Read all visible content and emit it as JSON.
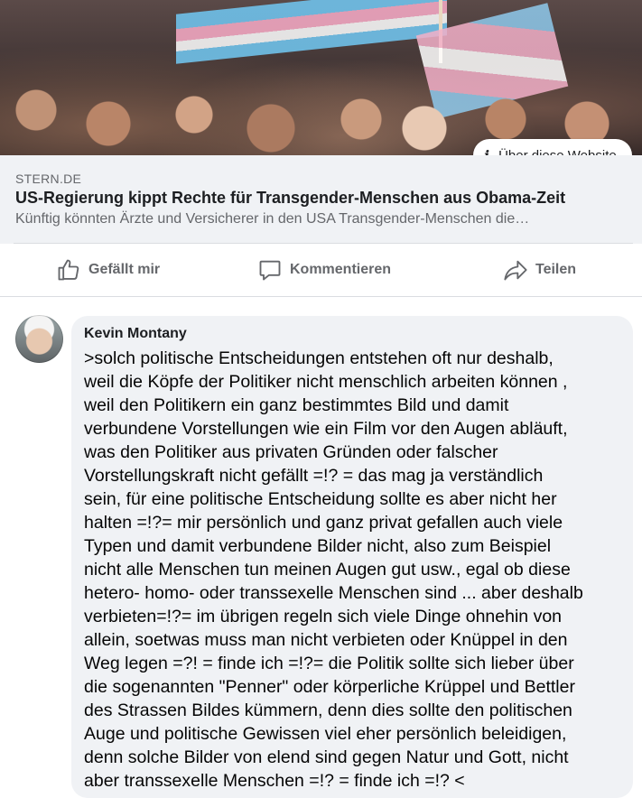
{
  "link_preview": {
    "about_label": "Über diese Website",
    "domain": "STERN.DE",
    "title": "US-Regierung kippt Rechte für Transgender-Menschen aus Obama-Zeit",
    "description": "Künftig könnten Ärzte und Versicherer in den USA Transgender-Menschen die…"
  },
  "actions": {
    "like": "Gefällt mir",
    "comment": "Kommentieren",
    "share": "Teilen"
  },
  "comment": {
    "author": "Kevin Montany",
    "text": ">solch politische Entscheidungen entstehen oft nur deshalb,\nweil die Köpfe der Politiker nicht menschlich arbeiten können ,\nweil den Politikern ein ganz bestimmtes Bild und damit\nverbundene Vorstellungen wie ein Film vor den Augen abläuft,\nwas den Politiker aus privaten Gründen oder falscher\nVorstellungskraft nicht gefällt =!? = das mag ja verständlich\nsein, für eine politische Entscheidung sollte es aber nicht her\nhalten =!?= mir persönlich und ganz privat gefallen auch viele\nTypen und damit verbundene Bilder nicht, also zum Beispiel\nnicht alle Menschen tun meinen Augen gut usw., egal ob diese\nhetero- homo- oder transsexelle Menschen sind ... aber deshalb\nverbieten=!?= im übrigen regeln sich viele Dinge ohnehin von\nallein, soetwas muss man nicht verbieten oder Knüppel in den\nWeg legen =?! = finde ich =!?= die Politik sollte sich lieber über\ndie sogenannten \"Penner\" oder körperliche Krüppel und Bettler\ndes Strassen Bildes kümmern, denn dies sollte den politischen\nAuge und politische Gewissen viel eher persönlich beleidigen,\ndenn solche Bilder von elend sind gegen Natur und Gott, nicht\naber  transsexelle Menschen =!? = finde ich =!? <"
  },
  "icons": {
    "about": "info-icon",
    "like": "thumbs-up-icon",
    "comment": "speech-bubble-icon",
    "share": "share-arrow-icon"
  }
}
